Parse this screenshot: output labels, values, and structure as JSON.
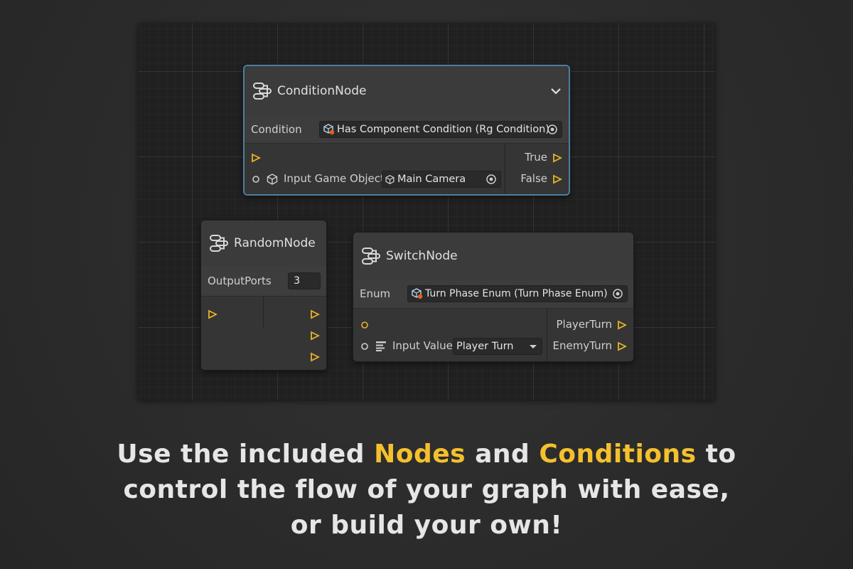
{
  "condition_node": {
    "title": "ConditionNode",
    "condition_label": "Condition",
    "condition_value": "Has Component Condition (Rg Condition)",
    "input_label": "Input Game Object",
    "input_value": "Main Camera",
    "out_true": "True",
    "out_false": "False"
  },
  "random_node": {
    "title": "RandomNode",
    "output_ports_label": "OutputPorts",
    "output_ports_value": "3"
  },
  "switch_node": {
    "title": "SwitchNode",
    "enum_label": "Enum",
    "enum_value": "Turn Phase Enum (Turn Phase Enum)",
    "input_label": "Input Value",
    "input_value": "Player Turn",
    "out_1": "PlayerTurn",
    "out_2": "EnemyTurn"
  },
  "caption": {
    "line1_a": "Use the included ",
    "line1_hl1": "Nodes",
    "line1_b": " and ",
    "line1_hl2": "Conditions",
    "line1_c": " to",
    "line2": "control the flow of your graph with ease,",
    "line3": "or build your own!"
  },
  "colors": {
    "accent": "#f5c02d",
    "selection": "#4b7f9f",
    "port": "#e6b32a"
  }
}
